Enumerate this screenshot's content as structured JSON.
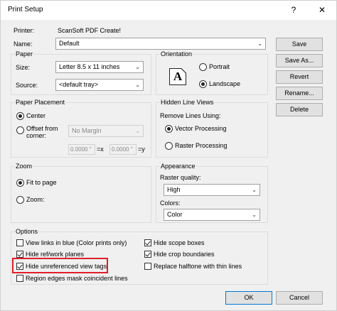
{
  "window": {
    "title": "Print Setup",
    "help_glyph": "?",
    "close_glyph": "✕"
  },
  "printer": {
    "label": "Printer:",
    "value": "ScanSoft PDF Create!"
  },
  "name": {
    "label": "Name:",
    "value": "Default"
  },
  "buttons": {
    "save": "Save",
    "save_as": "Save As...",
    "revert": "Revert",
    "rename": "Rename...",
    "delete": "Delete",
    "ok": "OK",
    "cancel": "Cancel"
  },
  "paper": {
    "label": "Paper",
    "size_label": "Size:",
    "size_value": "Letter   8.5 x 11 inches",
    "source_label": "Source:",
    "source_value": "<default tray>"
  },
  "orientation": {
    "label": "Orientation",
    "portrait": "Portrait",
    "landscape": "Landscape",
    "selected": "landscape",
    "icon_letter": "A"
  },
  "paper_placement": {
    "label": "Paper Placement",
    "center": "Center",
    "offset": "Offset from corner:",
    "margin_value": "No Margin",
    "x_value": "0.0000 \"",
    "x_label": "=x",
    "y_value": "0.0000 \"",
    "y_label": "=y",
    "selected": "center"
  },
  "hidden_line": {
    "label": "Hidden Line Views",
    "remove_label": "Remove Lines Using:",
    "vector": "Vector Processing",
    "raster": "Raster Processing",
    "selected": "vector"
  },
  "zoom": {
    "label": "Zoom",
    "fit": "Fit to page",
    "zoom": "Zoom:",
    "selected": "fit"
  },
  "appearance": {
    "label": "Appearance",
    "raster_quality_label": "Raster quality:",
    "raster_quality_value": "High",
    "colors_label": "Colors:",
    "colors_value": "Color"
  },
  "options": {
    "label": "Options",
    "items": [
      {
        "label": "View links in blue (Color prints only)",
        "checked": false
      },
      {
        "label": "Hide ref/work planes",
        "checked": true
      },
      {
        "label": "Hide unreferenced view tags",
        "checked": true
      },
      {
        "label": "Region edges mask coincident lines",
        "checked": false
      },
      {
        "label": "Hide scope boxes",
        "checked": true
      },
      {
        "label": "Hide crop boundaries",
        "checked": true
      },
      {
        "label": "Replace halftone with thin lines",
        "checked": false
      }
    ]
  },
  "dropdown_arrow": "⌄",
  "highlight_color": "#e01f2a"
}
